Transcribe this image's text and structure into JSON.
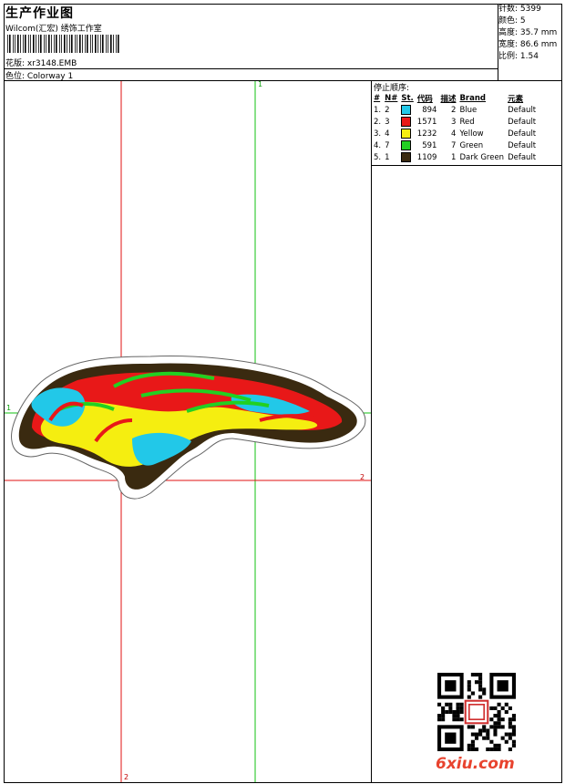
{
  "header": {
    "title": "生产作业图",
    "subtitle": "Wilcom(汇宏) 绣饰工作室",
    "design_label": "花版: xr3148.EMB",
    "colorway_label": "色位:  Colorway 1"
  },
  "stats": {
    "stitches": "针数: 5399",
    "colors": "颜色: 5",
    "height": "高度: 35.7 mm",
    "width": "宽度: 86.6 mm",
    "scale": "比例: 1.54"
  },
  "stop_sequence": {
    "heading": "停止顺序:",
    "columns": [
      "#",
      "N#",
      "St.",
      "代码",
      "描述",
      "Brand",
      "元素"
    ],
    "rows": [
      {
        "seq": "1.",
        "n": "2",
        "color": "#22c8e8",
        "st": "894",
        "code": "2",
        "desc": "Blue",
        "brand": "Default"
      },
      {
        "seq": "2.",
        "n": "3",
        "color": "#e81818",
        "st": "1571",
        "code": "3",
        "desc": "Red",
        "brand": "Default"
      },
      {
        "seq": "3.",
        "n": "4",
        "color": "#f5ee10",
        "st": "1232",
        "code": "4",
        "desc": "Yellow",
        "brand": "Default"
      },
      {
        "seq": "4.",
        "n": "7",
        "color": "#22d022",
        "st": "591",
        "code": "7",
        "desc": "Green",
        "brand": "Default"
      },
      {
        "seq": "5.",
        "n": "1",
        "color": "#3a2a10",
        "st": "1109",
        "code": "1",
        "desc": "Dark Green",
        "brand": "Default"
      }
    ]
  },
  "guides": {
    "top_label": "1",
    "left_label": "1",
    "right_label": "2",
    "bottom_label": "2"
  },
  "watermark": "6xiu.com",
  "colors": {
    "red_guide": "#e01010",
    "green_guide": "#10c010"
  }
}
